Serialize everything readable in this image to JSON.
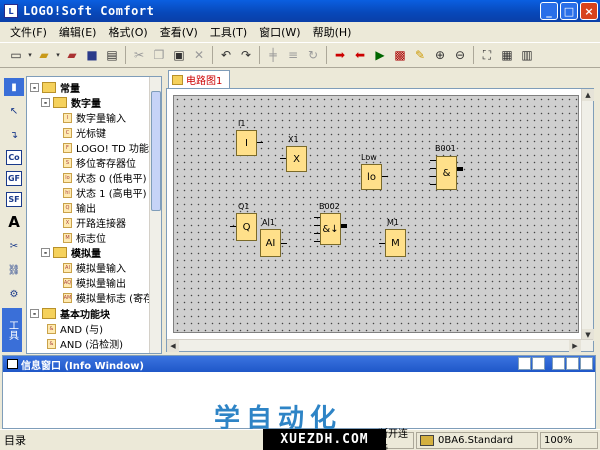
{
  "window": {
    "title": "LOGO!Soft Comfort"
  },
  "menu": [
    "文件(F)",
    "编辑(E)",
    "格式(O)",
    "查看(V)",
    "工具(T)",
    "窗口(W)",
    "帮助(H)"
  ],
  "tree": {
    "root": "常量",
    "digital": "数字量",
    "digital_items": [
      {
        "code": "I",
        "label": "数字量输入"
      },
      {
        "code": "C",
        "label": "光标键"
      },
      {
        "code": "F",
        "label": "LOGO! TD 功能键"
      },
      {
        "code": "S",
        "label": "移位寄存器位"
      },
      {
        "code": "lo",
        "label": "状态 0 (低电平)"
      },
      {
        "code": "hi",
        "label": "状态 1 (高电平)"
      },
      {
        "code": "Q",
        "label": "输出"
      },
      {
        "code": "X",
        "label": "开路连接器"
      },
      {
        "code": "M",
        "label": "标志位"
      }
    ],
    "analog": "模拟量",
    "analog_items": [
      {
        "code": "AI",
        "label": "模拟量输入"
      },
      {
        "code": "AQ",
        "label": "模拟量输出"
      },
      {
        "code": "AM",
        "label": "模拟量标志 (寄存"
      }
    ],
    "basic": "基本功能块",
    "basic_items": [
      {
        "code": "&",
        "label": "AND (与)"
      },
      {
        "code": "&",
        "label": "AND (沿检测)"
      }
    ]
  },
  "side_tab": "工具",
  "doc_tab": "电路图1",
  "blocks": [
    {
      "id": "I1",
      "body": "I"
    },
    {
      "id": "X1",
      "body": "X"
    },
    {
      "id": "Low",
      "body": "lo"
    },
    {
      "id": "B001",
      "body": "&"
    },
    {
      "id": "Q1",
      "body": "Q"
    },
    {
      "id": "AI1",
      "body": "AI"
    },
    {
      "id": "B002",
      "body": "&↓"
    },
    {
      "id": "M1",
      "body": "M"
    }
  ],
  "info_window": {
    "title": "信息窗口 (Info Window)"
  },
  "watermark": "学自动化",
  "watermark_url": "XUEZDH.COM",
  "status": {
    "main": "目录",
    "connection": "断开连接",
    "device": "0BA6.Standard",
    "zoom": "100%"
  }
}
